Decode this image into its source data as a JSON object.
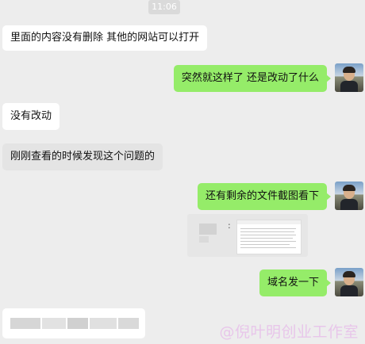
{
  "timestamp": "11:06",
  "messages": [
    {
      "side": "in",
      "text": "里面的内容没有删除   其他的网站可以打开"
    },
    {
      "side": "out",
      "text": "突然就这样了 还是改动了什么"
    },
    {
      "side": "in",
      "text": "没有改动"
    },
    {
      "side": "in",
      "text": "刚刚查看的时候发现这个问题的"
    },
    {
      "side": "out",
      "text": "还有剩余的文件截图看下"
    },
    {
      "side": "out",
      "text": "域名发一下"
    }
  ],
  "file_card": {
    "separator": ":"
  },
  "watermark": "@倪叶明创业工作室",
  "colors": {
    "outgoing_bubble": "#95ec69",
    "incoming_bubble": "#ffffff",
    "background": "#ededed"
  }
}
